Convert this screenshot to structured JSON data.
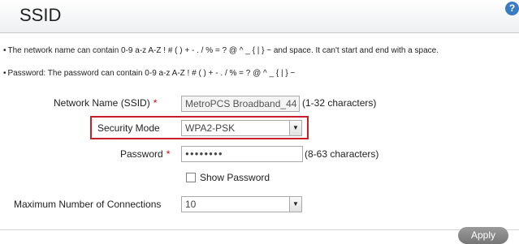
{
  "header": {
    "title": "SSID",
    "help_label": "?"
  },
  "notes": {
    "network_name": "The network name can contain 0-9 a-z A-Z ! # ( ) + - . / % = ? @ ^ _ { | } ~ and space. It can't start and end with a space.",
    "password": "Password: The password can contain 0-9 a-z A-Z ! # ( ) + - . / % = ? @ ^ _ { | } ~"
  },
  "form": {
    "network_name": {
      "label": "Network Name (SSID)",
      "required": "*",
      "value": "MetroPCS Broadband_44",
      "hint": "(1-32 characters)"
    },
    "security_mode": {
      "label": "Security Mode",
      "value": "WPA2-PSK"
    },
    "password": {
      "label": "Password",
      "required": "*",
      "value": "●●●●●●●●",
      "hint": "(8-63 characters)"
    },
    "show_password": {
      "label": "Show Password",
      "checked": false
    },
    "max_connections": {
      "label": "Maximum Number of Connections",
      "value": "10"
    }
  },
  "actions": {
    "apply_label": "Apply"
  },
  "colors": {
    "highlight": "#c8202a",
    "required": "#d00000",
    "help": "#3a7cc4"
  }
}
